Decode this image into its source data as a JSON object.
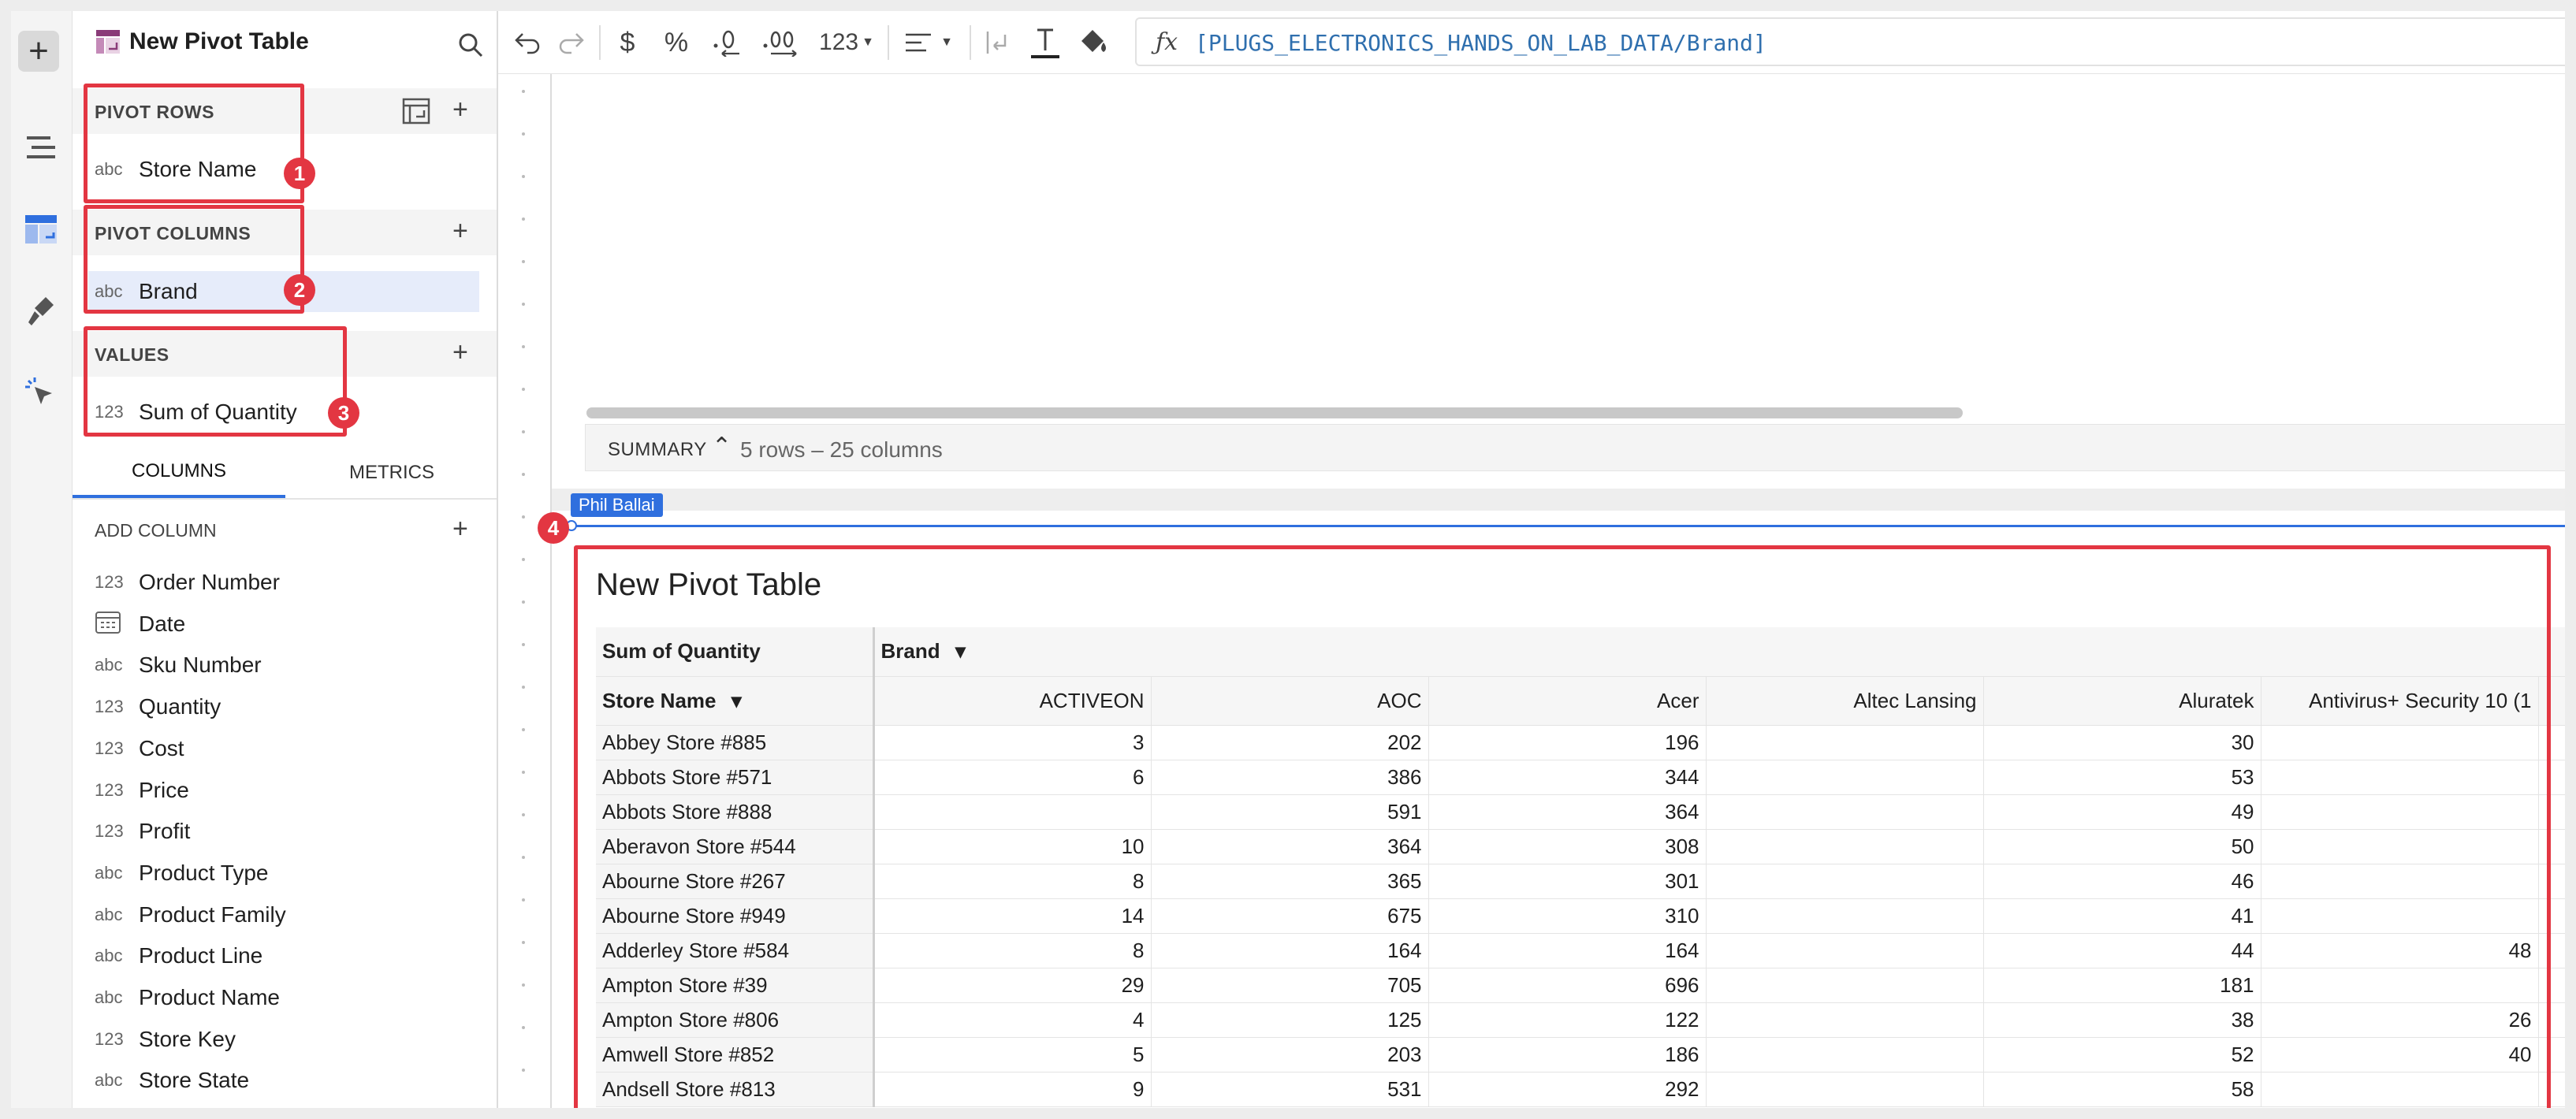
{
  "panel": {
    "title": "New Pivot Table",
    "pivot_rows": {
      "label": "PIVOT ROWS",
      "field": {
        "type": "abc",
        "name": "Store Name"
      }
    },
    "pivot_columns": {
      "label": "PIVOT COLUMNS",
      "field": {
        "type": "abc",
        "name": "Brand"
      }
    },
    "values": {
      "label": "VALUES",
      "field": {
        "type": "123",
        "name": "Sum of Quantity"
      }
    },
    "tabs": [
      "COLUMNS",
      "METRICS"
    ],
    "add_column_label": "ADD COLUMN",
    "columns": [
      {
        "type": "123",
        "name": "Order Number"
      },
      {
        "type": "date",
        "name": "Date"
      },
      {
        "type": "abc",
        "name": "Sku Number"
      },
      {
        "type": "123",
        "name": "Quantity"
      },
      {
        "type": "123",
        "name": "Cost"
      },
      {
        "type": "123",
        "name": "Price"
      },
      {
        "type": "123",
        "name": "Profit"
      },
      {
        "type": "abc",
        "name": "Product Type"
      },
      {
        "type": "abc",
        "name": "Product Family"
      },
      {
        "type": "abc",
        "name": "Product Line"
      },
      {
        "type": "abc",
        "name": "Product Name"
      },
      {
        "type": "123",
        "name": "Store Key"
      },
      {
        "type": "abc",
        "name": "Store State"
      }
    ]
  },
  "badges": [
    "1",
    "2",
    "3",
    "4"
  ],
  "toolbar": {
    "number_format_label": "123",
    "currency": "$",
    "percent": "%",
    "formula": "[PLUGS_ELECTRONICS_HANDS_ON_LAB_DATA/Brand]"
  },
  "summary": {
    "label": "SUMMARY",
    "info": "5 rows – 25 columns"
  },
  "user_tag": "Phil Ballai",
  "pivot": {
    "title": "New Pivot Table",
    "value_header": "Sum of Quantity",
    "column_field": "Brand",
    "row_field": "Store Name",
    "columns": [
      "ACTIVEON",
      "AOC",
      "Acer",
      "Altec Lansing",
      "Aluratek",
      "Antivirus+ Security 10 (1"
    ],
    "rows": [
      {
        "store": "Abbey Store #885",
        "values": [
          "3",
          "202",
          "196",
          "",
          "30",
          ""
        ]
      },
      {
        "store": "Abbots Store #571",
        "values": [
          "6",
          "386",
          "344",
          "",
          "53",
          ""
        ]
      },
      {
        "store": "Abbots Store #888",
        "values": [
          "",
          "591",
          "364",
          "",
          "49",
          ""
        ]
      },
      {
        "store": "Aberavon Store #544",
        "values": [
          "10",
          "364",
          "308",
          "",
          "50",
          ""
        ]
      },
      {
        "store": "Abourne Store #267",
        "values": [
          "8",
          "365",
          "301",
          "",
          "46",
          ""
        ]
      },
      {
        "store": "Abourne Store #949",
        "values": [
          "14",
          "675",
          "310",
          "",
          "41",
          ""
        ]
      },
      {
        "store": "Adderley Store #584",
        "values": [
          "8",
          "164",
          "164",
          "",
          "44",
          "48"
        ]
      },
      {
        "store": "Ampton Store #39",
        "values": [
          "29",
          "705",
          "696",
          "",
          "181",
          ""
        ]
      },
      {
        "store": "Ampton Store #806",
        "values": [
          "4",
          "125",
          "122",
          "",
          "38",
          "26"
        ]
      },
      {
        "store": "Amwell Store #852",
        "values": [
          "5",
          "203",
          "186",
          "",
          "52",
          "40"
        ]
      },
      {
        "store": "Andsell Store #813",
        "values": [
          "9",
          "531",
          "292",
          "",
          "58",
          ""
        ]
      }
    ]
  },
  "colors": {
    "accent": "#2f6fde",
    "annotation_red": "#e33642"
  }
}
